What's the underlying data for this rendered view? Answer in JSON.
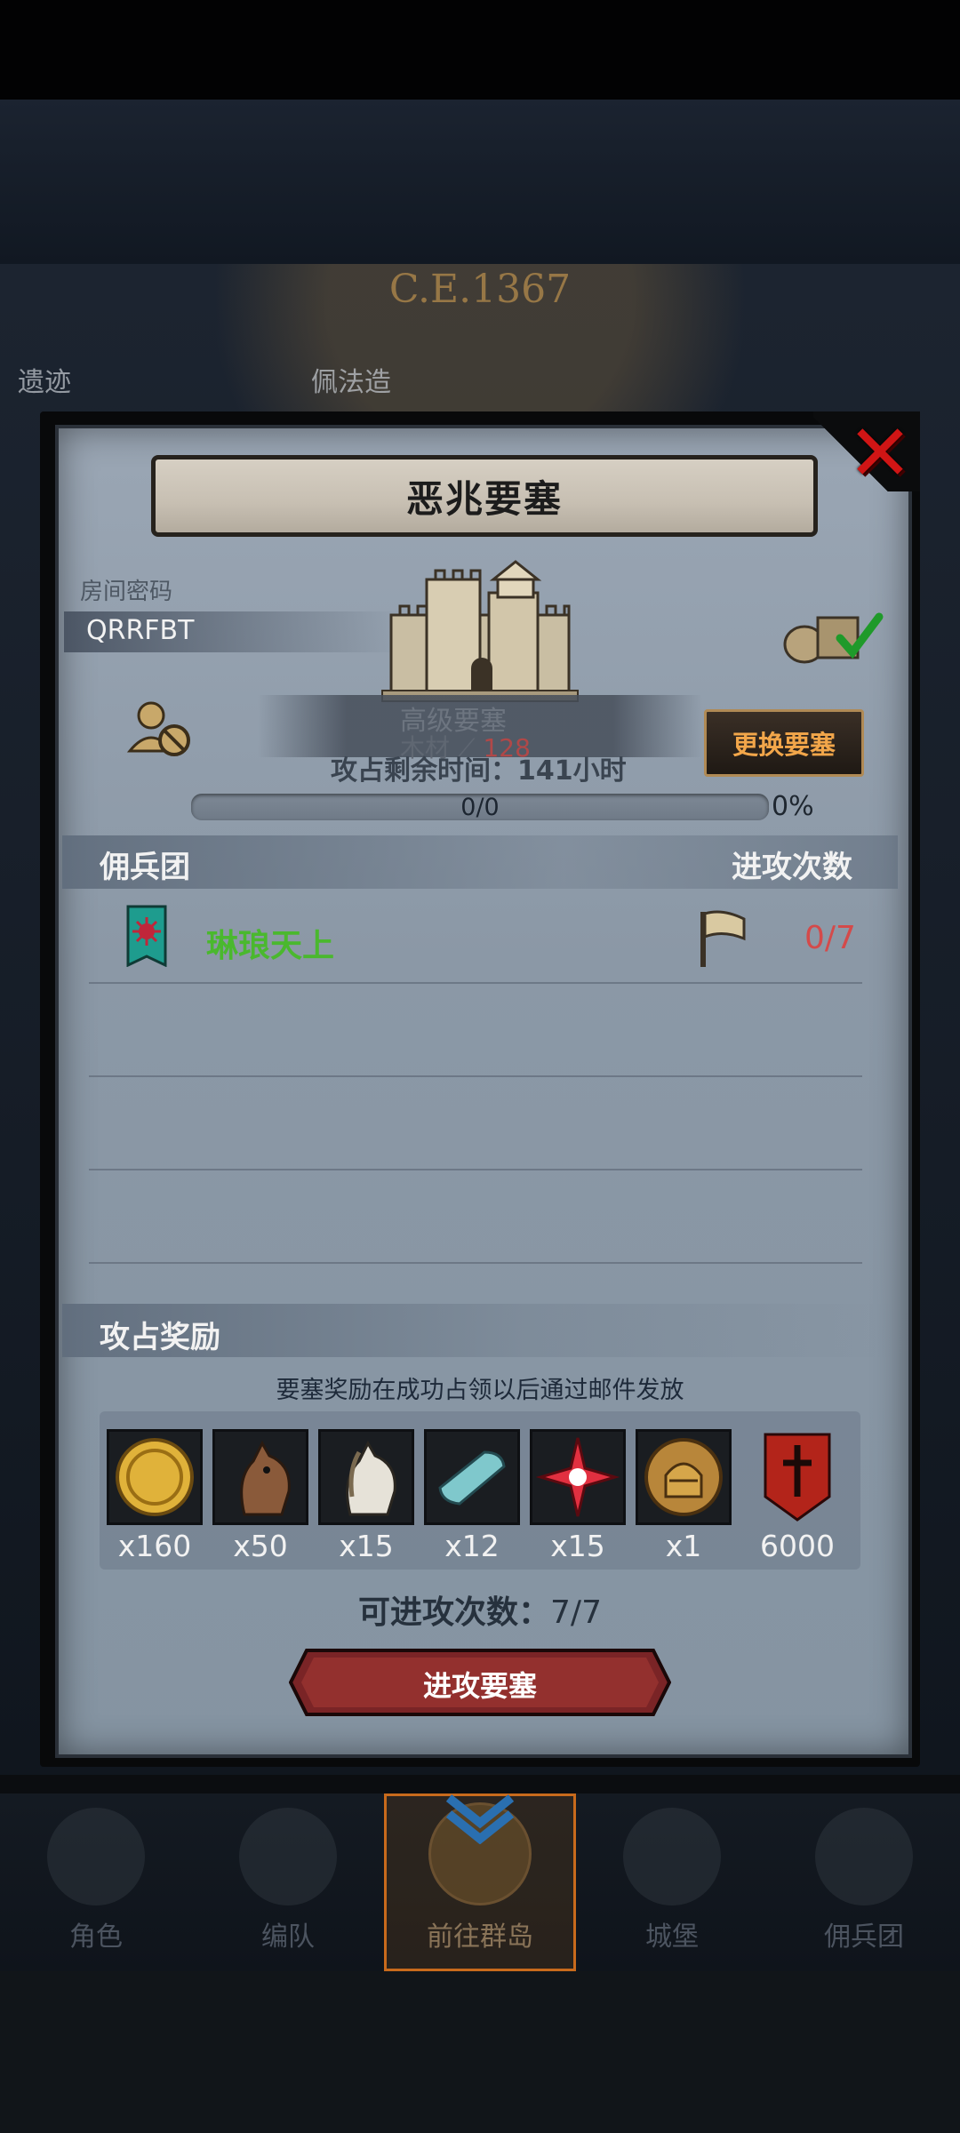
{
  "map": {
    "year": "C.E.1367",
    "label_left": "遗迹",
    "label_mid": "佩法造"
  },
  "dialog": {
    "title": "恶兆要塞",
    "room_label": "房间密码",
    "room_code": "QRRFBT",
    "castle_level": "高级要塞",
    "castle_resource_name": "木材",
    "castle_resource_value": "128",
    "attack_time": "攻占剩余时间：141小时",
    "change_button": "更换要塞",
    "progress_text": "0/0",
    "progress_percent": "0%",
    "progress_fraction": 0
  },
  "mercenary": {
    "header": "佣兵团",
    "attack_header": "进攻次数",
    "rows": [
      {
        "name": "琳琅天上",
        "count": "0/7"
      }
    ]
  },
  "rewards": {
    "header": "攻占奖励",
    "note": "要塞奖励在成功占领以后通过邮件发放",
    "items": [
      {
        "icon": "gold-coin-icon",
        "qty": "x160"
      },
      {
        "icon": "brown-horse-icon",
        "qty": "x50"
      },
      {
        "icon": "white-horse-icon",
        "qty": "x15"
      },
      {
        "icon": "cloth-roll-icon",
        "qty": "x12"
      },
      {
        "icon": "red-star-crystal-icon",
        "qty": "x15"
      },
      {
        "icon": "knight-helmet-coin-icon",
        "qty": "x1"
      },
      {
        "icon": "red-guild-banner-icon",
        "qty": "6000"
      }
    ]
  },
  "attack": {
    "count_label": "可进攻次数：",
    "count_value": "7/7",
    "button_label": "进攻要塞"
  },
  "nav": {
    "items": [
      {
        "label": "角色"
      },
      {
        "label": "编队"
      },
      {
        "label": "前往群岛"
      },
      {
        "label": "城堡"
      },
      {
        "label": "佣兵团"
      }
    ],
    "active_index": 2
  },
  "colors": {
    "accent_orange": "#f2a64a",
    "merc_name_green": "#4ab82e",
    "count_red": "#d44a4a",
    "close_red": "#d01515"
  }
}
